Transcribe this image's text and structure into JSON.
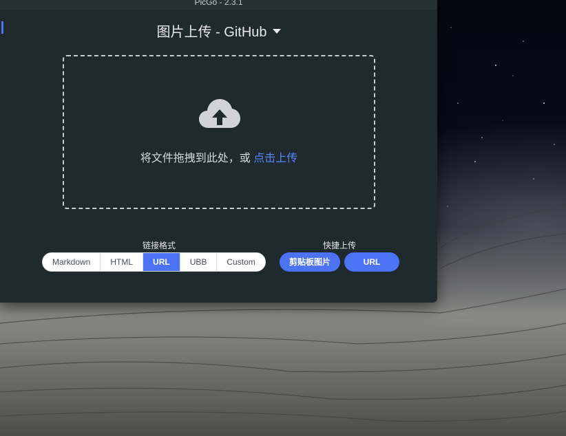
{
  "window": {
    "title": "PicGo - 2.3.1"
  },
  "header": {
    "picbed_title": "图片上传 - GitHub"
  },
  "dropzone": {
    "text": "将文件拖拽到此处，或 ",
    "link": "点击上传"
  },
  "link_format": {
    "label": "链接格式",
    "options": [
      "Markdown",
      "HTML",
      "URL",
      "UBB",
      "Custom"
    ],
    "selected": "URL"
  },
  "quick_upload": {
    "label": "快捷上传",
    "clipboard_button": "剪贴板图片",
    "url_button": "URL"
  },
  "colors": {
    "accent": "#4d73f5",
    "window_bg": "#1f2a2e",
    "link": "#5b84f7"
  },
  "icons": {
    "upload": "cloud-upload-icon",
    "dropdown": "caret-down-icon"
  }
}
